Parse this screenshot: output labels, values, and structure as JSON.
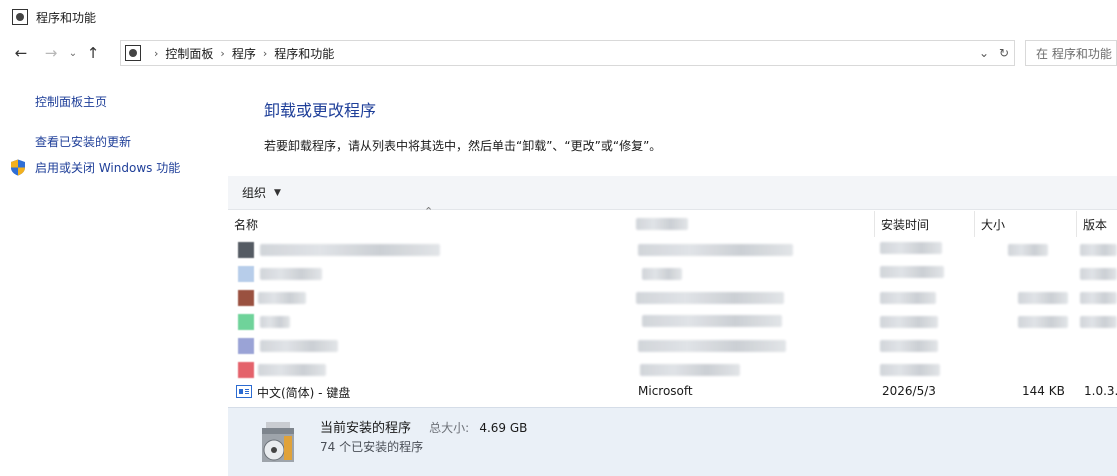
{
  "window": {
    "title": "程序和功能"
  },
  "address": {
    "breadcrumbs": [
      "控制面板",
      "程序",
      "程序和功能"
    ],
    "search_placeholder": "在 程序和功能"
  },
  "sidebar": {
    "links": [
      {
        "label": "控制面板主页"
      },
      {
        "label": "查看已安装的更新"
      },
      {
        "label": "启用或关闭 Windows 功能",
        "icon": "shield-icon"
      }
    ]
  },
  "main": {
    "title": "卸载或更改程序",
    "description": "若要卸载程序，请从列表中将其选中，然后单击“卸载”、“更改”或“修复”。"
  },
  "toolbar": {
    "organize_label": "组织"
  },
  "columns": {
    "name": "名称",
    "publisher": "",
    "installed_on": "安装时间",
    "size": "大小",
    "version": "版本"
  },
  "programs": [
    {
      "name": "中文(简体) - 键盘",
      "publisher": "Microsoft",
      "installed_on": "2026/5/3",
      "size": "144 KB",
      "version": "1.0.3."
    }
  ],
  "details": {
    "heading": "当前安装的程序",
    "total_size_label": "总大小:",
    "total_size_value": "4.69 GB",
    "count_text": "74 个已安装的程序"
  }
}
